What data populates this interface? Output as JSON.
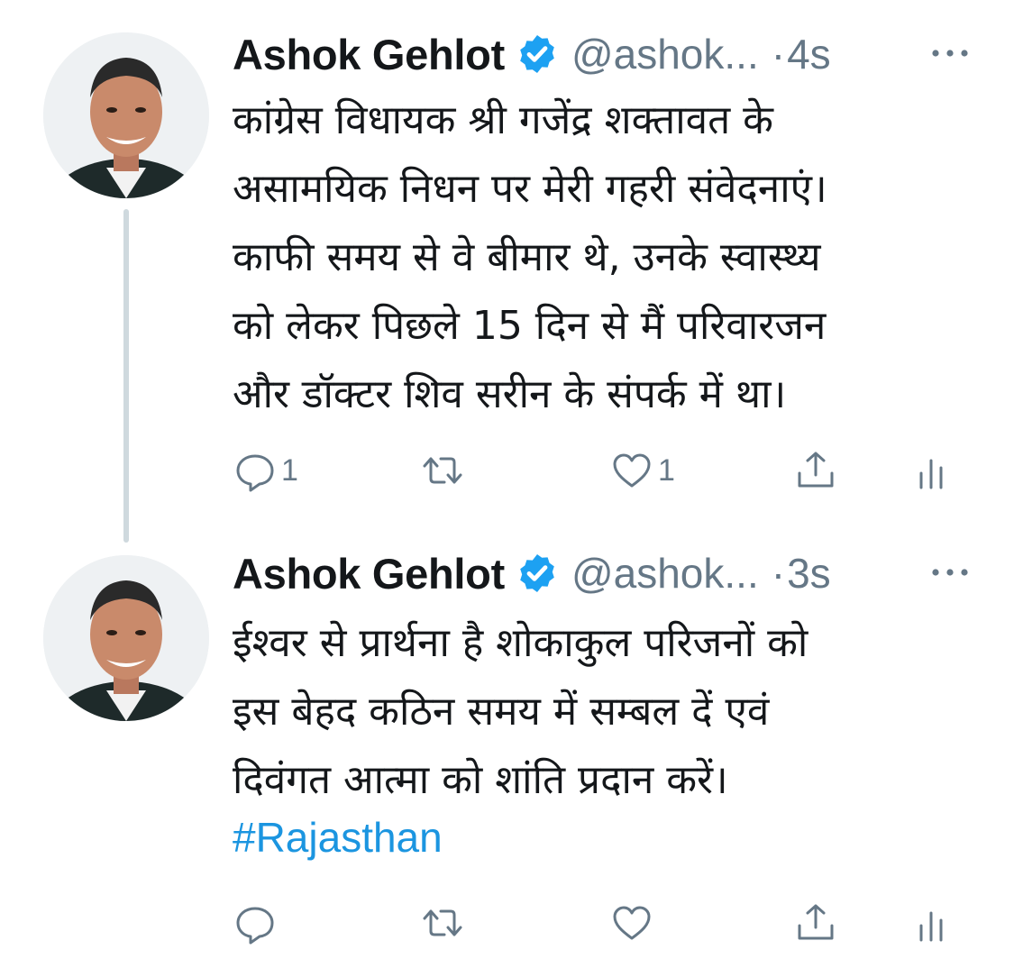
{
  "thread": [
    {
      "author": {
        "display_name": "Ashok Gehlot",
        "handle": "@ashok...",
        "verified": true
      },
      "separator": "·",
      "time": "4s",
      "text": "कांग्रेस विधायक श्री गजेंद्र शक्तावत के\nअसामयिक निधन पर मेरी गहरी संवेदनाएं।\nकाफी समय से वे बीमार थे, उनके स्वास्थ्य\nको लेकर पिछले 15 दिन से मैं परिवारजन\nऔर डॉक्टर शिव सरीन के संपर्क में था।",
      "hashtag": "",
      "actions": {
        "reply_count": "1",
        "retweet_count": "",
        "like_count": "1"
      }
    },
    {
      "author": {
        "display_name": "Ashok Gehlot",
        "handle": "@ashok...",
        "verified": true
      },
      "separator": "·",
      "time": "3s",
      "text": "ईश्वर से प्रार्थना है शोकाकुल परिजनों को\nइस बेहद कठिन समय में सम्बल दें एवं\nदिवंगत आत्मा को शांति प्रदान करें।",
      "hashtag": "#Rajasthan",
      "actions": {
        "reply_count": "",
        "retweet_count": "",
        "like_count": ""
      }
    }
  ],
  "icons": {
    "verified": "verified-badge-icon",
    "more": "more-options-icon",
    "reply": "reply-icon",
    "retweet": "retweet-icon",
    "like": "heart-icon",
    "share": "share-icon",
    "analytics": "analytics-icon"
  },
  "colors": {
    "text": "#14171a",
    "secondary": "#657786",
    "accent": "#1da1f2",
    "link": "#1b95e0",
    "thread_line": "#cfd9de"
  }
}
